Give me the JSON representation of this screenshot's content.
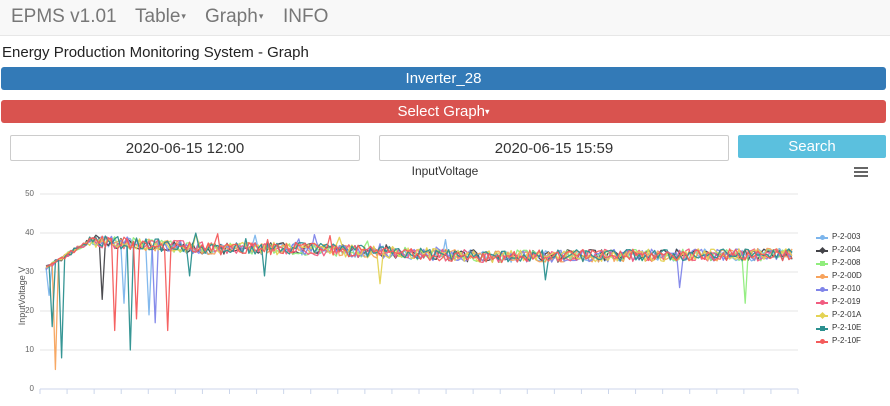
{
  "nav": {
    "brand": "EPMS v1.01",
    "items": [
      {
        "label": "Table",
        "dropdown": true
      },
      {
        "label": "Graph",
        "dropdown": true
      },
      {
        "label": "INFO",
        "dropdown": false
      }
    ]
  },
  "page": {
    "title": "Energy Production Monitoring System - Graph",
    "device_label": "Inverter_28",
    "graph_select_label": "Select Graph",
    "start_date": "2020-06-15 12:00",
    "end_date": "2020-06-15 15:59",
    "search_label": "Search"
  },
  "colors": {
    "nav_bg": "#f8f8f8",
    "primary": "#337ab7",
    "danger": "#d9534f",
    "info": "#5bc0de"
  },
  "chart_data": {
    "type": "line",
    "title": "InputVoltage",
    "ylabel": "InputVoltage V",
    "ylim": [
      0,
      50
    ],
    "yticks": [
      0,
      10,
      20,
      30,
      40,
      50
    ],
    "grid": true,
    "legend_position": "right",
    "x_points": 240,
    "series": [
      {
        "name": "P-2-003",
        "color": "#7cb5ec",
        "marker": "circle"
      },
      {
        "name": "P-2-004",
        "color": "#434348",
        "marker": "diamond"
      },
      {
        "name": "P-2-008",
        "color": "#90ed7d",
        "marker": "square"
      },
      {
        "name": "P-2-00D",
        "color": "#f7a35c",
        "marker": "triangle"
      },
      {
        "name": "P-2-010",
        "color": "#8085e9",
        "marker": "triangle-down"
      },
      {
        "name": "P-2-019",
        "color": "#f15c80",
        "marker": "circle"
      },
      {
        "name": "P-2-01A",
        "color": "#e4d354",
        "marker": "diamond"
      },
      {
        "name": "P-2-10E",
        "color": "#2b908f",
        "marker": "square"
      },
      {
        "name": "P-2-10F",
        "color": "#f45b5b",
        "marker": "triangle"
      }
    ],
    "profile": {
      "start": 31,
      "ramp_peak": 38,
      "plateau": 36,
      "mid": 34,
      "end": 34.5,
      "noise": 1.6
    },
    "dips": [
      {
        "series": "P-2-003",
        "x_index": 1,
        "y": 24
      },
      {
        "series": "P-2-10E",
        "x_index": 2,
        "y": 16
      },
      {
        "series": "P-2-00D",
        "x_index": 3,
        "y": 5
      },
      {
        "series": "P-2-10E",
        "x_index": 5,
        "y": 8
      },
      {
        "series": "P-2-004",
        "x_index": 18,
        "y": 23
      },
      {
        "series": "P-2-10F",
        "x_index": 22,
        "y": 15
      },
      {
        "series": "P-2-003",
        "x_index": 25,
        "y": 22
      },
      {
        "series": "P-2-10E",
        "x_index": 27,
        "y": 10
      },
      {
        "series": "P-2-10F",
        "x_index": 29,
        "y": 18
      },
      {
        "series": "P-2-003",
        "x_index": 33,
        "y": 19
      },
      {
        "series": "P-2-010",
        "x_index": 35,
        "y": 17
      },
      {
        "series": "P-2-10F",
        "x_index": 39,
        "y": 15
      },
      {
        "series": "P-2-10E",
        "x_index": 46,
        "y": 29
      },
      {
        "series": "P-2-10E",
        "x_index": 70,
        "y": 29
      },
      {
        "series": "P-2-01A",
        "x_index": 107,
        "y": 27
      },
      {
        "series": "P-2-10E",
        "x_index": 160,
        "y": 28
      },
      {
        "series": "P-2-010",
        "x_index": 203,
        "y": 26
      },
      {
        "series": "P-2-008",
        "x_index": 224,
        "y": 22
      }
    ]
  }
}
